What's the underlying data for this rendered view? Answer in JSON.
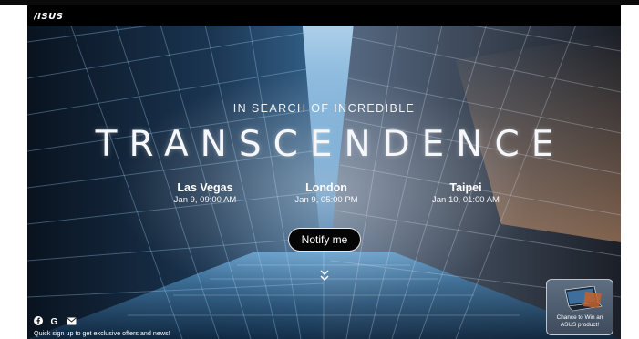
{
  "brand": {
    "logo_text": "/ISUS"
  },
  "hero": {
    "tagline": "IN SEARCH OF INCREDIBLE",
    "headline": "TRANSCENDENCE",
    "cities": [
      {
        "name": "Las Vegas",
        "time": "Jan 9, 09:00 AM"
      },
      {
        "name": "London",
        "time": "Jan 9, 05:00 PM"
      },
      {
        "name": "Taipei",
        "time": "Jan 10, 01:00 AM"
      }
    ],
    "notify_label": "Notify me",
    "scroll_icon": "chevron-double-down-icon"
  },
  "footer": {
    "social_icons": [
      "facebook-icon",
      "google-icon",
      "email-icon"
    ],
    "signup_text": "Quick sign up to get exclusive offers and news!"
  },
  "promo": {
    "text_line1": "Chance to Win an",
    "text_line2": "ASUS product!"
  },
  "colors": {
    "topbar": "#000000",
    "button_bg": "#050505",
    "text": "#ffffff",
    "sky_blue": "#4f8fc0"
  }
}
